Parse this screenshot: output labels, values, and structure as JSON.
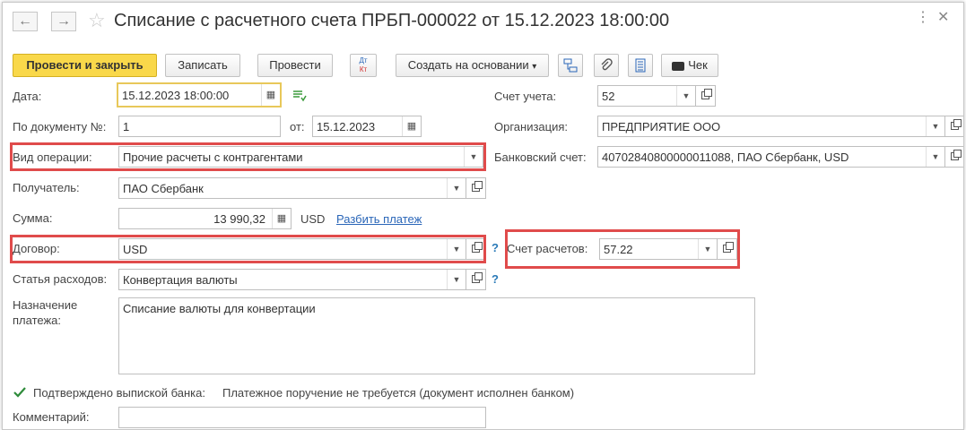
{
  "window": {
    "title": "Списание с расчетного счета ПРБП-000022 от 15.12.2023 18:00:00",
    "back_icon": "←",
    "forward_icon": "→",
    "star_icon": "☆",
    "more_icon": "⋮",
    "close_icon": "✕"
  },
  "toolbar": {
    "post_and_close": "Провести и закрыть",
    "save": "Записать",
    "post": "Провести",
    "dt_label": "Дт",
    "kt_label": "Кт",
    "create_based_on": "Создать на основании",
    "create_based_on_arrow": "▾",
    "check": "Чек"
  },
  "form": {
    "date": {
      "label": "Дата:",
      "value": "15.12.2023 18:00:00"
    },
    "doc_number": {
      "label": "По документу №:",
      "value": "1"
    },
    "doc_from": {
      "label": "от:",
      "value": "15.12.2023"
    },
    "operation": {
      "label": "Вид операции:",
      "value": "Прочие расчеты с контрагентами"
    },
    "recipient": {
      "label": "Получатель:",
      "value": "ПАО Сбербанк"
    },
    "amount": {
      "label": "Сумма:",
      "value": "13 990,32",
      "currency": "USD",
      "split_link": "Разбить платеж"
    },
    "contract": {
      "label": "Договор:",
      "value": "USD",
      "help": "?"
    },
    "expense_item": {
      "label": "Статья расходов:",
      "value": "Конвертация валюты",
      "help": "?"
    },
    "purpose": {
      "label": "Назначение платежа:",
      "value": "Списание валюты для конвертации"
    },
    "confirmed": {
      "label": "Подтверждено выпиской банка:",
      "checked": true,
      "note": "Платежное поручение не требуется (документ исполнен банком)"
    },
    "comment": {
      "label": "Комментарий:",
      "value": ""
    },
    "account": {
      "label": "Счет учета:",
      "value": "52"
    },
    "organization": {
      "label": "Организация:",
      "value": "ПРЕДПРИЯТИЕ ООО"
    },
    "bank_account": {
      "label": "Банковский счет:",
      "value": "40702840800000011088, ПАО Сбербанк, USD"
    },
    "settlement_account": {
      "label": "Счет расчетов:",
      "value": "57.22"
    }
  },
  "colors": {
    "primary_button": "#f9d84a",
    "highlight_border": "#e04b4b",
    "link": "#2a66b8",
    "active_field_border": "#e8c85a"
  }
}
